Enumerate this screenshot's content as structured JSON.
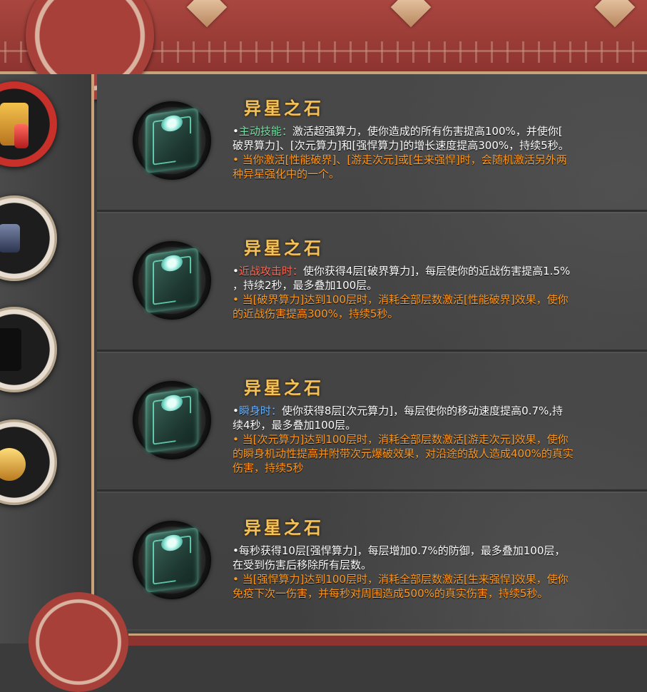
{
  "skills": [
    {
      "title": "异星之石",
      "line1_prefix": "•",
      "line1_keyword": "主动技能",
      "line1_colon": "：",
      "line1_text": "激活超强算力，使你造成的所有伤害提高100%，并使你[",
      "line2_text": "破界算力]、[次元算力]和[强悍算力]的增长速度提高300%，持续5秒。",
      "line3_text": "• 当你激活[性能破界]、[游走次元]或[生来强悍]时，会随机激活另外两",
      "line4_text": "种异星强化中的一个。"
    },
    {
      "title": "异星之石",
      "line1_prefix": "•",
      "line1_keyword": "近战攻击时",
      "line1_colon": "：",
      "line1_text": "使你获得4层[破界算力]，每层使你的近战伤害提高1.5%",
      "line2_text": "，持续2秒，最多叠加100层。",
      "line3_text": "• 当[破界算力]达到100层时，消耗全部层数激活[性能破界]效果，使你",
      "line4_text": "的近战伤害提高300%，持续5秒。"
    },
    {
      "title": "异星之石",
      "line1_prefix": "•",
      "line1_keyword": "瞬身时",
      "line1_colon": "：",
      "line1_text": "使你获得8层[次元算力]，每层使你的移动速度提高0.7%,持",
      "line2_text": "续4秒，最多叠加100层。",
      "line3_text": "• 当[次元算力]达到100层时，消耗全部层数激活[游走次元]效果，使你",
      "line4_text": "的瞬身机动性提高并附带次元爆破效果，对沿途的敌人造成400%的真实",
      "line5_text": "伤害，持续5秒"
    },
    {
      "title": "异星之石",
      "line1_prefix": "•",
      "line1_text": "每秒获得10层[强悍算力]，每层增加0.7%的防御，最多叠加100层，",
      "line2_text": "在受到伤害后移除所有层数。",
      "line3_text": "• 当[强悍算力]达到100层时，消耗全部层数激活[生来强悍]效果，使你",
      "line4_text": "免疫下次一伤害，并每秒对周围造成500%的真实伤害，持续5秒。"
    }
  ],
  "colors": {
    "title": "#f3c25a",
    "keyword_active": "#7de0a6",
    "keyword_melee": "#ff6a55",
    "keyword_blink": "#6cb4ff",
    "effect_text": "#ff9a1f",
    "panel_bg": "#444444",
    "banner_red": "#a9463f"
  },
  "icons": [
    "alien-stone-gem-icon",
    "sidebar-character-icon"
  ]
}
